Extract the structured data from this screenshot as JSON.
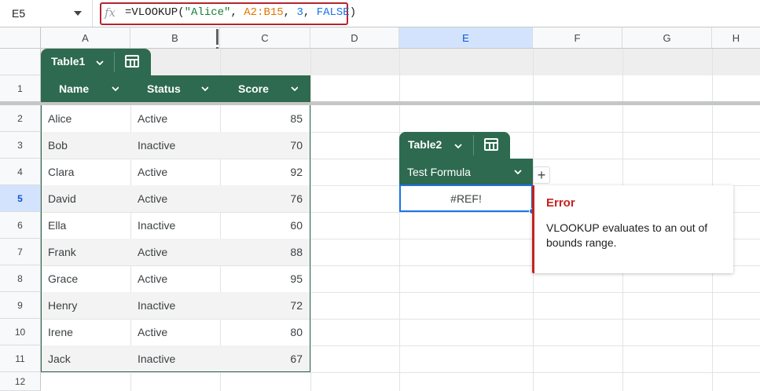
{
  "formula_bar": {
    "name_box": "E5",
    "fx": "fx",
    "formula": {
      "fn": "=VLOOKUP(",
      "arg1": "\"Alice\"",
      "sep1": ", ",
      "arg2": "A2:B15",
      "sep2": ", ",
      "arg3": "3",
      "sep3": ", ",
      "arg4": "FALSE",
      "close": ")"
    }
  },
  "columns": [
    "A",
    "B",
    "C",
    "D",
    "E",
    "F",
    "G",
    "H"
  ],
  "selected_column": "E",
  "rows": [
    "1",
    "2",
    "3",
    "4",
    "5",
    "6",
    "7",
    "8",
    "9",
    "10",
    "11",
    "12"
  ],
  "selected_row": "5",
  "table1": {
    "name": "Table1",
    "headers": [
      "Name",
      "Status",
      "Score"
    ],
    "rows": [
      {
        "name": "Alice",
        "status": "Active",
        "score": "85"
      },
      {
        "name": "Bob",
        "status": "Inactive",
        "score": "70"
      },
      {
        "name": "Clara",
        "status": "Active",
        "score": "92"
      },
      {
        "name": "David",
        "status": "Active",
        "score": "76"
      },
      {
        "name": "Ella",
        "status": "Inactive",
        "score": "60"
      },
      {
        "name": "Frank",
        "status": "Active",
        "score": "88"
      },
      {
        "name": "Grace",
        "status": "Active",
        "score": "95"
      },
      {
        "name": "Henry",
        "status": "Inactive",
        "score": "72"
      },
      {
        "name": "Irene",
        "status": "Active",
        "score": "80"
      },
      {
        "name": "Jack",
        "status": "Inactive",
        "score": "67"
      }
    ]
  },
  "table2": {
    "name": "Table2",
    "header": "Test Formula",
    "value": "#REF!"
  },
  "error_popup": {
    "title": "Error",
    "message": "VLOOKUP evaluates to an out of bounds range."
  },
  "add_column_label": "+",
  "colors": {
    "table_green": "#2d6a4f",
    "error_red": "#c5221f",
    "selection_blue": "#1a73e8"
  }
}
